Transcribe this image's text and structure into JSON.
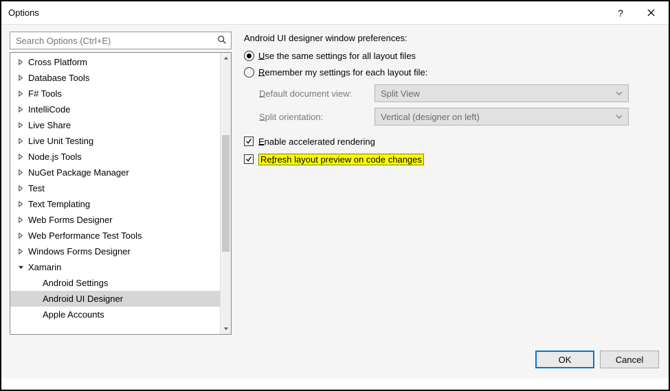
{
  "window": {
    "title": "Options",
    "help_label": "?",
    "close_label": "Close"
  },
  "search": {
    "placeholder": "Search Options (Ctrl+E)"
  },
  "tree": {
    "items": [
      {
        "label": "Cross Platform",
        "state": "collapsed"
      },
      {
        "label": "Database Tools",
        "state": "collapsed"
      },
      {
        "label": "F# Tools",
        "state": "collapsed"
      },
      {
        "label": "IntelliCode",
        "state": "collapsed"
      },
      {
        "label": "Live Share",
        "state": "collapsed"
      },
      {
        "label": "Live Unit Testing",
        "state": "collapsed"
      },
      {
        "label": "Node.js Tools",
        "state": "collapsed"
      },
      {
        "label": "NuGet Package Manager",
        "state": "collapsed"
      },
      {
        "label": "Test",
        "state": "collapsed"
      },
      {
        "label": "Text Templating",
        "state": "collapsed"
      },
      {
        "label": "Web Forms Designer",
        "state": "collapsed"
      },
      {
        "label": "Web Performance Test Tools",
        "state": "collapsed"
      },
      {
        "label": "Windows Forms Designer",
        "state": "collapsed"
      },
      {
        "label": "Xamarin",
        "state": "expanded"
      }
    ],
    "children": [
      {
        "label": "Android Settings",
        "selected": false
      },
      {
        "label": "Android UI Designer",
        "selected": true
      },
      {
        "label": "Apple Accounts",
        "selected": false
      }
    ]
  },
  "panel": {
    "heading": "Android UI designer window preferences:",
    "radio1_u": "U",
    "radio1_rest": "se the same settings for all layout files",
    "radio2_u": "R",
    "radio2_rest": "emember my settings for each layout file:",
    "default_view_u": "D",
    "default_view_rest": "efault document view:",
    "default_view_value": "Split View",
    "split_orient_u": "S",
    "split_orient_rest": "plit orientation:",
    "split_orient_value": "Vertical (designer on left)",
    "check1_u": "E",
    "check1_rest": "nable accelerated rendering",
    "check2_pre": "Re",
    "check2_u": "f",
    "check2_rest": "resh layout preview on code changes"
  },
  "footer": {
    "ok": "OK",
    "cancel": "Cancel"
  }
}
